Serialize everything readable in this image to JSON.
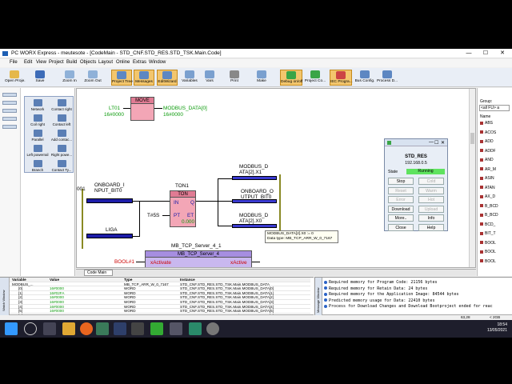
{
  "window": {
    "title": "PC WORX Express - meutesote - [CodeMain - STD_CNF.STD_RES.STD_TSK.Main.Code]",
    "min": "—",
    "max": "☐",
    "close": "✕"
  },
  "menu": [
    "File",
    "Edit",
    "View",
    "Project",
    "Build",
    "Objects",
    "Layout",
    "Online",
    "Extras",
    "Window"
  ],
  "toolbar": [
    "Open Proje.",
    "Save",
    "Zoom In",
    "Zoom Out",
    "Project Tree",
    "Messages",
    "EditWizard",
    "Variables",
    "Vars",
    "Print",
    "Make",
    "Debug on/off",
    "Project Co...",
    "IEC Progra...",
    "Bus Config.",
    "Process D..."
  ],
  "palette": [
    "Network",
    "Contact right",
    "Coil right",
    "Contact left",
    "Parallel",
    "Add contac...",
    "Left powerrail",
    "Right powe...",
    "Branch",
    "Contact Ty..."
  ],
  "diagram": {
    "move_title": "MOVE",
    "lt01": "LT01",
    "lt01_val": "16#0000",
    "modbus_data0": "MODBUS_DATA[0]",
    "modbus_data0_val": "16#0000",
    "rung": "001",
    "onboard_in": "ONBOARD_I",
    "onboard_in2": "NPUT_BIT0",
    "ton_title": "TON1",
    "ton_type": "TON",
    "ton_in": "IN",
    "ton_q": "Q",
    "ton_pt": "PT",
    "ton_et": "ET",
    "ton_et_val": "0.000",
    "t55": "T#5S",
    "liga": "LIGA",
    "coil1a": "MODBUS_D",
    "coil1b": "ATA[2].X1",
    "coil2a": "ONBOARD_O",
    "coil2b": "UTPUT_BIT0",
    "coil3a": "MODBUS_D",
    "coil3b": "ATA[2].X0",
    "server_title": "MB_TCP_Server_4_1",
    "server_type": "MB_TCP_Server_4",
    "bool1": "BOOL#1",
    "xactivate": "xActivate",
    "xactive": "xActive"
  },
  "code_tab": "Code Main",
  "tooltip": {
    "line1": "MODBUS_DATA[2].X0 := 0",
    "line2": "Data type: MB_TCP_ARR_W_0_7167"
  },
  "popup": {
    "name": "STD_RES",
    "ip": "192.168.0.5",
    "state_label": "State",
    "state_value": "Running",
    "buttons": [
      [
        "Stop",
        "Cold"
      ],
      [
        "Reset",
        "Warm"
      ],
      [
        "Error",
        "Hot"
      ],
      [
        "Download",
        "Upload"
      ],
      [
        "More..",
        "Info"
      ],
      [
        "Close",
        "Help"
      ]
    ]
  },
  "side_panel": {
    "group_label": "Group:",
    "group_value": "<all FU> a",
    "name_header": "Name",
    "items": [
      "ABS",
      "ACOS",
      "ADD",
      "ADDF",
      "AND",
      "AR_M",
      "ASIN",
      "ATAN",
      "AX_D",
      "B_BCD",
      "B_BCD",
      "BCD_",
      "BIT_T",
      "BOOL",
      "BOOL",
      "BOOL"
    ]
  },
  "watch": {
    "headers": [
      "Variable",
      "Value",
      "Type",
      "Instance"
    ],
    "rows": [
      [
        "MODBUS_...",
        "",
        "MB_TCP_ARR_W_0_7167",
        "STD_CNF.STD_RES.STD_TSK.Main.MODBUS_DATA"
      ],
      [
        "[0]",
        "16#0000",
        "WORD",
        "STD_CNF.STD_RES.STD_TSK.Main.MODBUS_DATA[0]"
      ],
      [
        "[1]",
        "16#02FA",
        "WORD",
        "STD_CNF.STD_RES.STD_TSK.Main.MODBUS_DATA[1]"
      ],
      [
        "[2]",
        "16#0000",
        "WORD",
        "STD_CNF.STD_RES.STD_TSK.Main.MODBUS_DATA[2]"
      ],
      [
        "[3]",
        "16#0000",
        "WORD",
        "STD_CNF.STD_RES.STD_TSK.Main.MODBUS_DATA[3]"
      ],
      [
        "[4]",
        "16#0000",
        "WORD",
        "STD_CNF.STD_RES.STD_TSK.Main.MODBUS_DATA[4]"
      ],
      [
        "[5]",
        "16#0000",
        "WORD",
        "STD_CNF.STD_RES.STD_TSK.Main.MODBUS_DATA[5]"
      ],
      [
        "[6]",
        "16#0000",
        "WORD",
        "STD_CNF.STD_RES.STD_TSK.Main.MODBUS_DATA[6]"
      ]
    ],
    "tabs": [
      "Watch 1",
      "Watch 2",
      "Watch 3",
      "Watch 4",
      "Watch 5",
      "Watch 6",
      "Watch 7",
      "Watch 8",
      "Watch 9",
      "Watch 10"
    ],
    "side_label": "Watch Window"
  },
  "messages": {
    "lines": [
      "Required memory for Program Code: 21156 bytes",
      "Required memory for Retain Data: 24 bytes",
      "Required memory for the Application Image: 84544 bytes",
      "Predicted memory usage for Data: 22410 bytes",
      "Process for Download Changes and Download Bootproject ended for reac"
    ],
    "tabs": [
      "Build",
      "Errors",
      "Warnings",
      "Info",
      "PLC Errors",
      "Print",
      "Bus Configurator"
    ],
    "side_label": "Message Window"
  },
  "status": {
    "pos": "63,28",
    "mem": "< 2GB"
  },
  "tray": {
    "time": "18:54",
    "date": "13/05/2021"
  },
  "colors": {
    "accent": "#f3c66d",
    "block": "#f3a6b6",
    "coil": "#3a3ad0",
    "active": "#0a9a0a"
  }
}
